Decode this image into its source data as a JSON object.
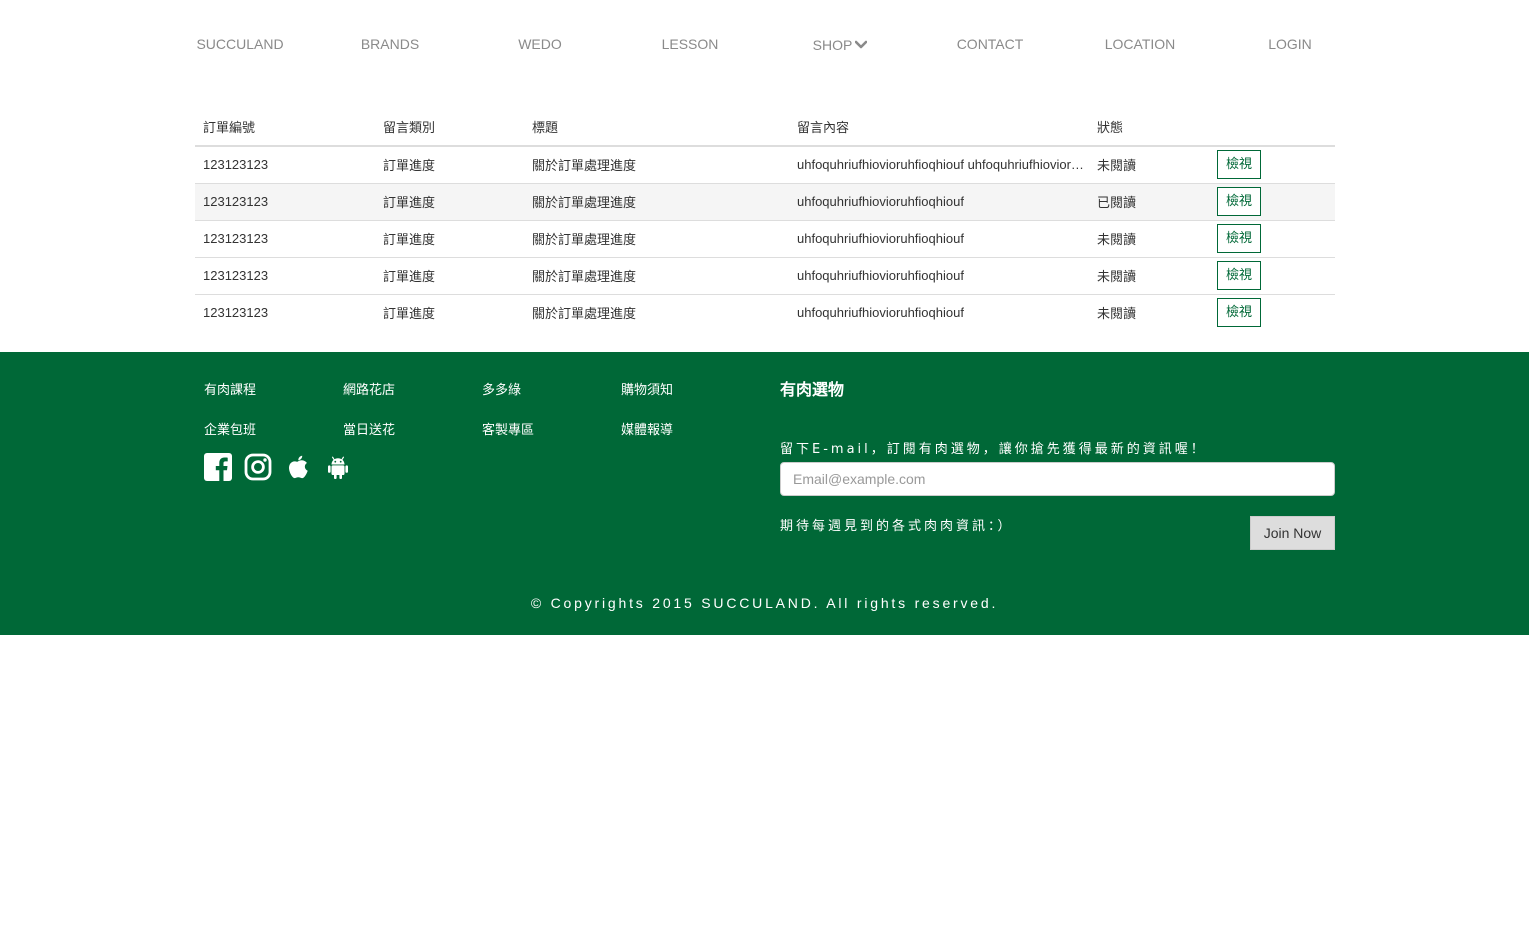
{
  "nav": {
    "items": [
      {
        "label": "SUCCULAND"
      },
      {
        "label": "BRANDS"
      },
      {
        "label": "WEDO"
      },
      {
        "label": "LESSON"
      },
      {
        "label": "SHOP",
        "icon": "chevron-down-icon"
      },
      {
        "label": "CONTACT"
      },
      {
        "label": "LOCATION"
      },
      {
        "label": "LOGIN"
      }
    ]
  },
  "table": {
    "headers": [
      "訂單編號",
      "留言類別",
      "標題",
      "留言內容",
      "狀態",
      ""
    ],
    "rows": [
      {
        "order": "123123123",
        "category": "訂單進度",
        "title": "關於訂單處理進度",
        "content": "uhfoquhriufhiovioruhfioqhiouf uhfoquhriufhiovioruhfioqhiouf",
        "status": "未閱讀",
        "status_type": "unread",
        "action": "檢視"
      },
      {
        "order": "123123123",
        "category": "訂單進度",
        "title": "關於訂單處理進度",
        "content": "uhfoquhriufhiovioruhfioqhiouf",
        "status": "已閱讀",
        "status_type": "read",
        "action": "檢視"
      },
      {
        "order": "123123123",
        "category": "訂單進度",
        "title": "關於訂單處理進度",
        "content": "uhfoquhriufhiovioruhfioqhiouf",
        "status": "未閱讀",
        "status_type": "unread",
        "action": "檢視"
      },
      {
        "order": "123123123",
        "category": "訂單進度",
        "title": "關於訂單處理進度",
        "content": "uhfoquhriufhiovioruhfioqhiouf",
        "status": "未閱讀",
        "status_type": "unread",
        "action": "檢視"
      },
      {
        "order": "123123123",
        "category": "訂單進度",
        "title": "關於訂單處理進度",
        "content": "uhfoquhriufhiovioruhfioqhiouf",
        "status": "未閱讀",
        "status_type": "unread",
        "action": "檢視"
      }
    ]
  },
  "footer": {
    "links": [
      "有肉課程",
      "網路花店",
      "多多綠",
      "購物須知",
      "企業包班",
      "當日送花",
      "客製專區",
      "媒體報導"
    ],
    "social": [
      "facebook-icon",
      "instagram-icon",
      "apple-icon",
      "android-icon"
    ],
    "subscribe": {
      "title": "有肉選物",
      "description": "留下E-mail，訂閱有肉選物，讓你搶先獲得最新的資訊喔！",
      "placeholder": "Email@example.com",
      "note": "期待每週見到的各式肉肉資訊：）",
      "button": "Join Now"
    },
    "copyright": "© Copyrights 2015 SUCCULAND. All rights reserved."
  },
  "colors": {
    "brand_green": "#006837",
    "unread": "#d9001b",
    "read": "#2e8b2e",
    "nav_text": "#8a8a8a"
  }
}
